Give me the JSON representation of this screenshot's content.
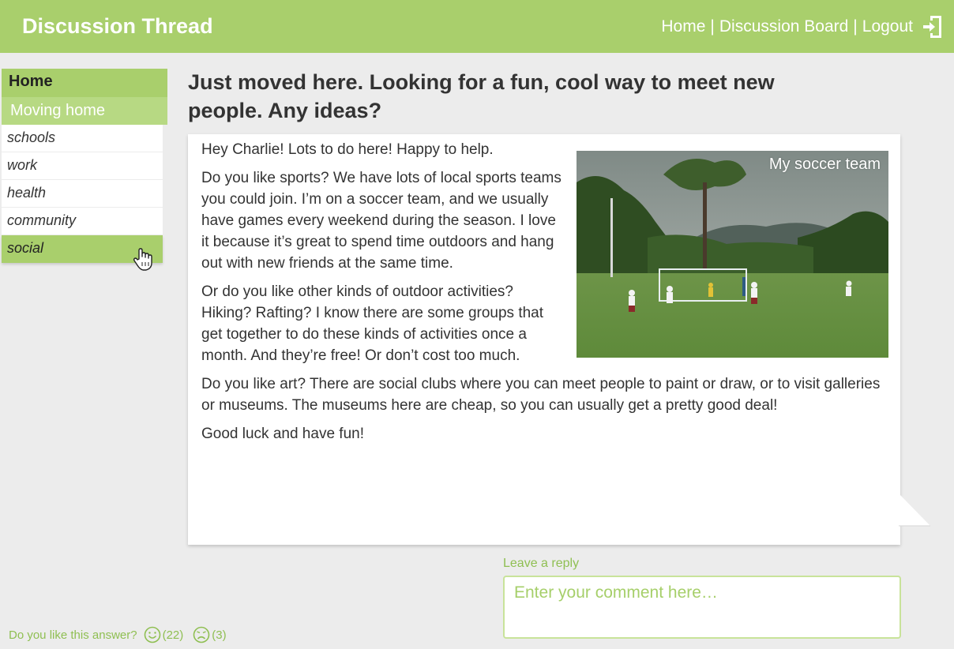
{
  "header": {
    "title": "Discussion Thread",
    "nav": [
      "Home",
      "Discussion Board",
      "Logout"
    ],
    "separator": "|"
  },
  "sidebar": {
    "home": "Home",
    "section": "Moving home",
    "items": [
      "schools",
      "work",
      "health",
      "community",
      "social"
    ],
    "active_item": "social"
  },
  "question": "Just moved here. Looking for a fun, cool way to meet new people. Any ideas?",
  "answer": {
    "paragraphs": [
      "Hey Charlie! Lots to do here! Happy to help.",
      "Do you like sports? We have lots of local sports teams you could join. I’m on a soccer team, and we usually have games every weekend during the season. I love it because it’s great to spend time outdoors and hang out with new friends at the same time.",
      "Or do you like other kinds of outdoor activities? Hiking? Rafting? I know there are some groups that get together to do these kinds of activities once a month. And they’re free! Or don’t cost too much.",
      "Do you like art? There are social clubs where you can meet people to paint or draw, or to visit galleries or museums. The museums here are cheap, so you can usually get a pretty good deal!",
      "Good luck and have fun!"
    ],
    "photo_caption": "My soccer team"
  },
  "reply": {
    "label": "Leave a reply",
    "placeholder": "Enter your comment here…"
  },
  "rating": {
    "question": "Do you like this answer?",
    "like_count": "(22)",
    "dislike_count": "(3)"
  },
  "colors": {
    "brand_green": "#a9cf6c",
    "light_green": "#b7d983",
    "text_green": "#8fbf52",
    "background": "#ececec"
  }
}
